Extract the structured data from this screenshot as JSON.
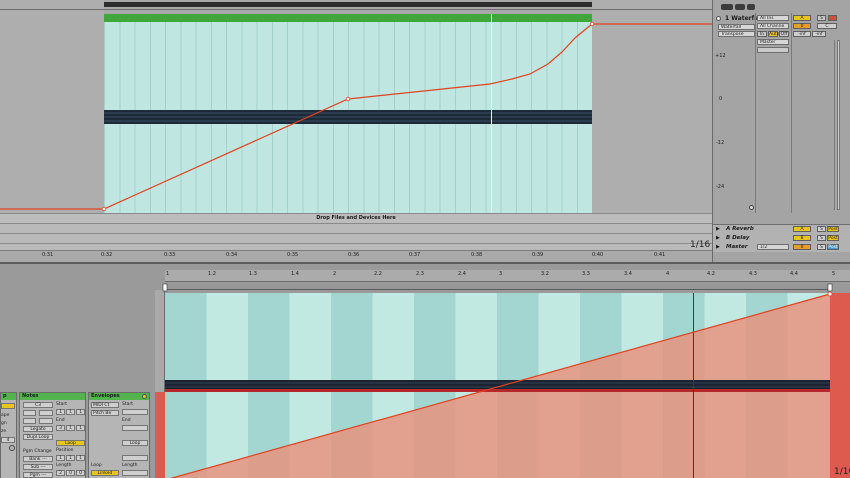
{
  "arrangement": {
    "drop_zone_text": "Drop Files and Devices Here",
    "ruler_ticks": [
      "0:31",
      "0:32",
      "0:33",
      "0:34",
      "0:35",
      "0:36",
      "0:37",
      "0:38",
      "0:39",
      "0:40",
      "0:41"
    ],
    "grid_label": "1/16"
  },
  "mixer": {
    "track_name": "1 Waterfall",
    "input_type": "All Ins",
    "input_channel": "All Channe",
    "monitor_in": "In",
    "monitor_auto": "Auto",
    "monitor_off": "Off",
    "output": "Master",
    "device_chain": "Waterfall",
    "envelope_param": "Transpose",
    "track_label_a": "A",
    "track_label_s": "S",
    "track_label_zero": "0",
    "track_label_c": "C",
    "volume": "-inf",
    "pan": "-inf",
    "db_labels": [
      "+12",
      "0",
      "-12",
      "-24"
    ],
    "returns": [
      {
        "name": "A Reverb",
        "letter": "A",
        "solo": "S",
        "post": "Post"
      },
      {
        "name": "B Delay",
        "letter": "B",
        "solo": "S",
        "post": "Post"
      },
      {
        "name": "Master",
        "letter": "0",
        "solo": "S",
        "post": "Post",
        "cue": "1/2"
      }
    ]
  },
  "detail": {
    "ruler_ticks": [
      "1",
      "1.2",
      "1.3",
      "1.4",
      "2",
      "2.2",
      "2.3",
      "2.4",
      "3",
      "3.2",
      "3.3",
      "3.4",
      "4",
      "4.2",
      "4.3",
      "4.4",
      "5"
    ],
    "grid_label": "1/16"
  },
  "clip_panels": {
    "clip": {
      "head": "p",
      "labels": [
        "ape",
        "gn",
        "ze",
        "4"
      ]
    },
    "notes": {
      "head": "Notes",
      "note": "C3",
      "start_label": "Start",
      "end_label": "End",
      "legato": "Legato",
      "dupl_loop": "Dupl.Loop",
      "loop": "Loop",
      "position": "Position",
      "length": "Length",
      "pgm_change": "Pgm Change",
      "bank": "Bank ---",
      "sub": "Sub ---",
      "pgm": "Pgm ---",
      "start_val": [
        "1",
        "1",
        "1"
      ],
      "end_val": [
        "3",
        "1",
        "1"
      ],
      "pos_val": [
        "1",
        "1",
        "1"
      ],
      "len_val": [
        "2",
        "0",
        "0"
      ]
    },
    "envelopes": {
      "head": "Envelopes",
      "device": "MIDI Ct",
      "param": "Pitch Be",
      "start_label": "Start",
      "end_label": "End",
      "loop_label": "Loop",
      "length_label": "Length",
      "loop_btn": "Loop",
      "linked": "Linked"
    }
  },
  "colors": {
    "clip_body": "#bfe6e0",
    "clip_title": "#3ea63b",
    "automation": "#e0431f",
    "envelope_fill": "#e8937f",
    "note_bar": "#233445"
  }
}
